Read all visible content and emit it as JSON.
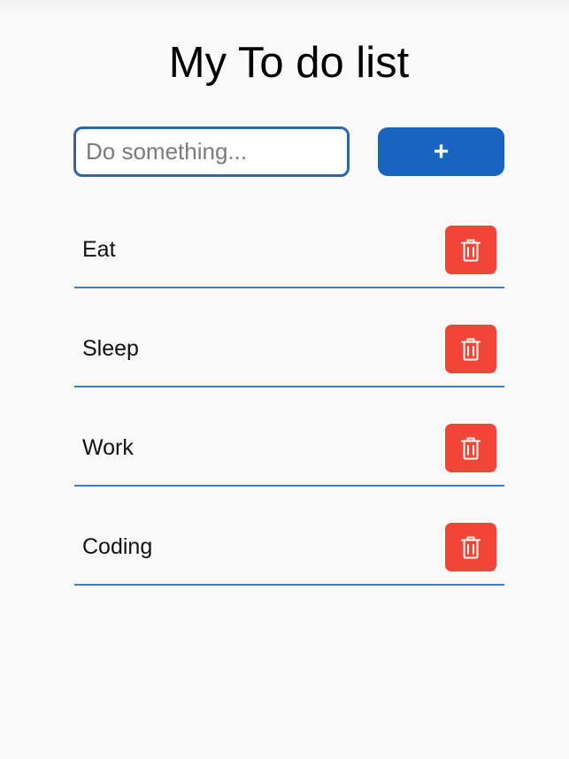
{
  "app": {
    "title": "My To do list"
  },
  "input": {
    "placeholder": "Do something...",
    "value": ""
  },
  "add_button": {
    "label": "+"
  },
  "todos": [
    {
      "label": "Eat",
      "delete_icon": "trash-icon"
    },
    {
      "label": "Sleep",
      "delete_icon": "trash-icon"
    },
    {
      "label": "Work",
      "delete_icon": "trash-icon"
    },
    {
      "label": "Coding",
      "delete_icon": "trash-icon"
    }
  ],
  "colors": {
    "primary": "#1765bf",
    "input_border": "#2b66b1",
    "divider": "#3a7dc9",
    "delete": "#f1453a",
    "background": "#fafafa"
  }
}
